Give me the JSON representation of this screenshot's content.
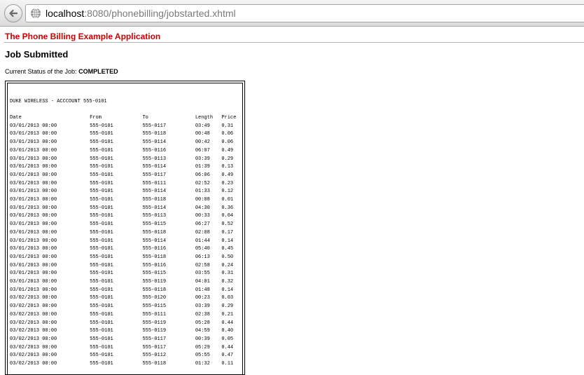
{
  "browser": {
    "url_host": "localhost",
    "url_rest": ":8080/phonebilling/jobstarted.xhtml"
  },
  "page": {
    "app_title": "The Phone Billing Example Application",
    "heading": "Job Submitted",
    "status_label": "Current Status of the Job:",
    "status_value": "COMPLETED"
  },
  "report": {
    "heading": "DUKE WIRELESS - ACCCOUNT 555-0101",
    "columns": [
      "Date",
      "From",
      "To",
      "Length",
      "Price"
    ],
    "rows": [
      [
        "03/01/2013 00:00",
        "555-0101",
        "555-0117",
        "03:49",
        "0.31"
      ],
      [
        "03/01/2013 00:00",
        "555-0101",
        "555-0118",
        "00:48",
        "0.06"
      ],
      [
        "03/01/2013 00:00",
        "555-0101",
        "555-0114",
        "00:42",
        "0.06"
      ],
      [
        "03/01/2013 00:00",
        "555-0101",
        "555-0116",
        "06:07",
        "0.49"
      ],
      [
        "03/01/2013 00:00",
        "555-0101",
        "555-0113",
        "03:39",
        "0.29"
      ],
      [
        "03/01/2013 00:00",
        "555-0101",
        "555-0114",
        "01:39",
        "0.13"
      ],
      [
        "03/01/2013 00:00",
        "555-0101",
        "555-0117",
        "06:06",
        "0.49"
      ],
      [
        "03/01/2013 00:00",
        "555-0101",
        "555-0111",
        "02:52",
        "0.23"
      ],
      [
        "03/01/2013 00:00",
        "555-0101",
        "555-0114",
        "01:33",
        "0.12"
      ],
      [
        "03/01/2013 00:00",
        "555-0101",
        "555-0118",
        "00:08",
        "0.01"
      ],
      [
        "03/01/2013 00:00",
        "555-0101",
        "555-0114",
        "04:30",
        "0.36"
      ],
      [
        "03/01/2013 00:00",
        "555-0101",
        "555-0113",
        "00:33",
        "0.04"
      ],
      [
        "03/01/2013 00:00",
        "555-0101",
        "555-0115",
        "06:27",
        "0.52"
      ],
      [
        "03/01/2013 00:00",
        "555-0101",
        "555-0118",
        "02:08",
        "0.17"
      ],
      [
        "03/01/2013 00:00",
        "555-0101",
        "555-0114",
        "01:44",
        "0.14"
      ],
      [
        "03/01/2013 00:00",
        "555-0101",
        "555-0116",
        "05:40",
        "0.45"
      ],
      [
        "03/01/2013 00:00",
        "555-0101",
        "555-0118",
        "06:13",
        "0.50"
      ],
      [
        "03/01/2013 00:00",
        "555-0101",
        "555-0116",
        "02:58",
        "0.24"
      ],
      [
        "03/01/2013 00:00",
        "555-0101",
        "555-0115",
        "03:55",
        "0.31"
      ],
      [
        "03/01/2013 00:00",
        "555-0101",
        "555-0119",
        "04:01",
        "0.32"
      ],
      [
        "03/01/2013 00:00",
        "555-0101",
        "555-0118",
        "01:48",
        "0.14"
      ],
      [
        "03/02/2013 00:00",
        "555-0101",
        "555-0120",
        "00:23",
        "0.03"
      ],
      [
        "03/02/2013 00:00",
        "555-0101",
        "555-0115",
        "03:39",
        "0.29"
      ],
      [
        "03/02/2013 00:00",
        "555-0101",
        "555-0111",
        "02:38",
        "0.21"
      ],
      [
        "03/02/2013 00:00",
        "555-0101",
        "555-0119",
        "05:28",
        "0.44"
      ],
      [
        "03/02/2013 00:00",
        "555-0101",
        "555-0119",
        "04:59",
        "0.40"
      ],
      [
        "03/02/2013 00:00",
        "555-0101",
        "555-0117",
        "00:39",
        "0.05"
      ],
      [
        "03/02/2013 00:00",
        "555-0101",
        "555-0117",
        "05:29",
        "0.44"
      ],
      [
        "03/02/2013 00:00",
        "555-0101",
        "555-0112",
        "05:55",
        "0.47"
      ],
      [
        "03/02/2013 00:00",
        "555-0101",
        "555-0118",
        "01:32",
        "0.11"
      ]
    ]
  }
}
